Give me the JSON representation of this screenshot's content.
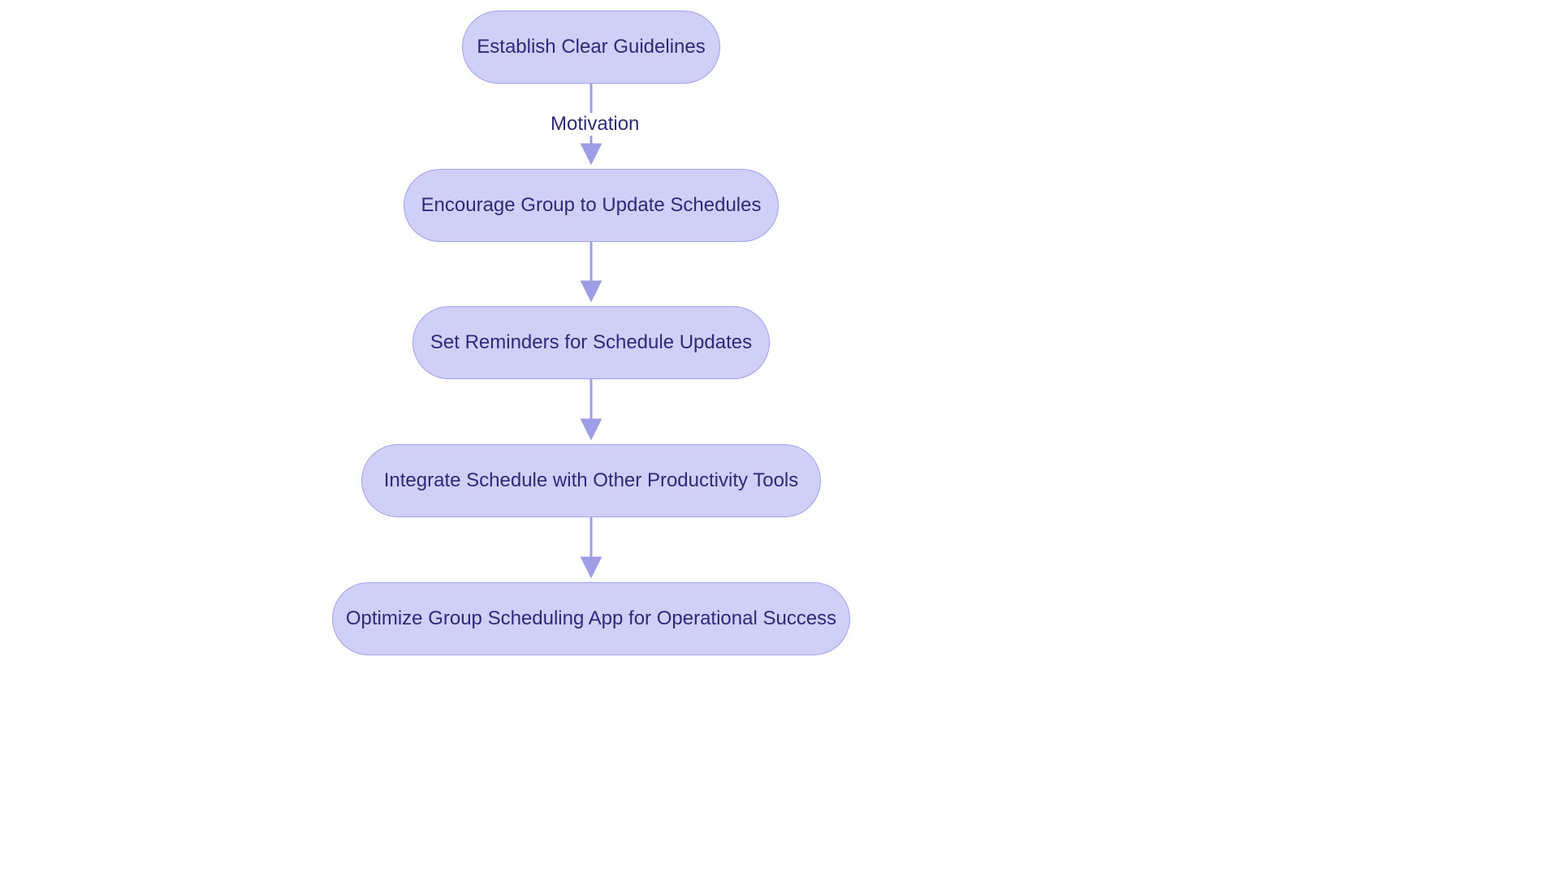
{
  "chart_data": {
    "type": "diagram",
    "diagram_kind": "flowchart-vertical",
    "nodes": [
      {
        "id": "n1",
        "label": "Establish Clear Guidelines"
      },
      {
        "id": "n2",
        "label": "Encourage Group to Update Schedules"
      },
      {
        "id": "n3",
        "label": "Set Reminders for Schedule Updates"
      },
      {
        "id": "n4",
        "label": "Integrate Schedule with Other Productivity Tools"
      },
      {
        "id": "n5",
        "label": "Optimize Group Scheduling App for Operational Success"
      }
    ],
    "edges": [
      {
        "from": "n1",
        "to": "n2",
        "label": "Motivation"
      },
      {
        "from": "n2",
        "to": "n3",
        "label": ""
      },
      {
        "from": "n3",
        "to": "n4",
        "label": ""
      },
      {
        "from": "n4",
        "to": "n5",
        "label": ""
      }
    ],
    "colors": {
      "node_fill": "#cfcff8",
      "node_stroke": "#a2a2ec",
      "text": "#2b2b7a",
      "arrow": "#9e9ee6"
    }
  }
}
